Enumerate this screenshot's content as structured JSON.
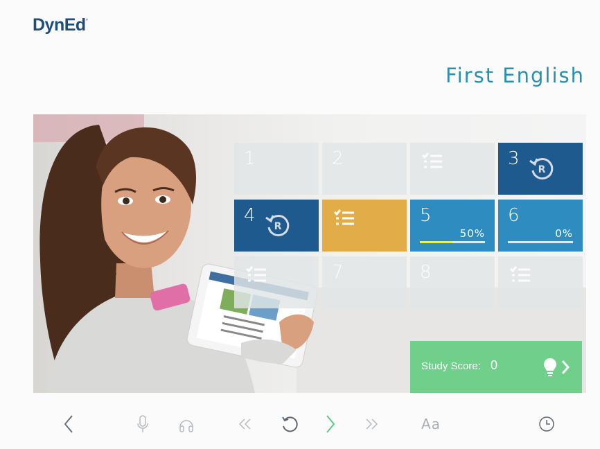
{
  "header": {
    "logo_text": "DynEd",
    "course_title": "First English"
  },
  "tiles": [
    {
      "label": "1",
      "state": "locked"
    },
    {
      "label": "2",
      "state": "locked"
    },
    {
      "label": "",
      "state": "locked-quiz",
      "icon": "checklist-icon"
    },
    {
      "label": "3",
      "state": "review",
      "icon": "review-icon"
    },
    {
      "label": "4",
      "state": "review",
      "icon": "review-icon"
    },
    {
      "label": "",
      "state": "quiz",
      "icon": "checklist-icon"
    },
    {
      "label": "5",
      "state": "in-progress",
      "progress_text": "50%",
      "progress": 0.5
    },
    {
      "label": "6",
      "state": "in-progress",
      "progress_text": "0%",
      "progress": 0.0
    },
    {
      "label": "",
      "state": "locked-quiz",
      "icon": "checklist-icon"
    },
    {
      "label": "7",
      "state": "locked"
    },
    {
      "label": "8",
      "state": "locked"
    },
    {
      "label": "",
      "state": "locked-quiz",
      "icon": "checklist-icon"
    }
  ],
  "study_score": {
    "label": "Study Score:",
    "value": "0",
    "icon": "lightbulb-icon",
    "arrow_icon": "chevron-right-icon"
  },
  "toolbar": {
    "items": [
      "back-icon",
      "microphone-icon",
      "headphones-icon",
      "rewind-icon",
      "replay-icon",
      "next-icon",
      "fast-forward-icon",
      "text-size",
      "clock-icon"
    ],
    "text_size_label": "Aa"
  },
  "colors": {
    "navy": "#1f5a8e",
    "blue": "#2f8cc0",
    "gold": "#e2ad48",
    "green": "#71cf8c",
    "title": "#2a8fae",
    "next_green": "#5cc98a"
  }
}
